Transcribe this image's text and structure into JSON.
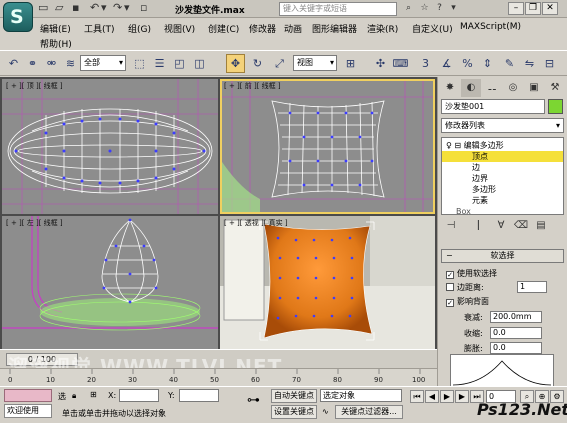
{
  "title": {
    "document": "沙发垫文件.max",
    "search_placeholder": "键入关键字或短语"
  },
  "menu": {
    "row1": [
      "编辑(E)",
      "工具(T)",
      "组(G)",
      "视图(V)",
      "创建(C)",
      "修改器",
      "动画",
      "图形编辑器",
      "渲染(R)",
      "自定义(U)",
      "MAXScript(M)"
    ],
    "row2": [
      "帮助(H)"
    ]
  },
  "toolbar": {
    "selection_filter": "全部",
    "ref_coord": "视图"
  },
  "viewports": {
    "top": "[ + ][ 顶 ][ 线框 ]",
    "front": "[ + ][ 前 ][ 线框 ]",
    "left": "[ + ][ 左 ][ 线框 ]",
    "persp": "[ + ][ 透视 ][ 真实 ]"
  },
  "command_panel": {
    "object_name": "沙发垫001",
    "object_color": "#7cd632",
    "modifier_list": "修改器列表",
    "stack": [
      "编辑多边形",
      "顶点",
      "边",
      "边界",
      "多边形",
      "元素",
      "Box"
    ],
    "stack_selected": "顶点",
    "rollout_title": "软选择",
    "use_soft_select": "使用软选择",
    "edge_distance": "边距离:",
    "edge_distance_value": "1",
    "affect_backfacing": "影响背面",
    "falloff_label": "衰减:",
    "falloff_value": "200.0mm",
    "pinch_label": "收缩:",
    "pinch_value": "0.0",
    "bubble_label": "膨胀:",
    "bubble_value": "0.0"
  },
  "timeline": {
    "slider_label": "0 / 100",
    "ticks": [
      "0",
      "10",
      "20",
      "30",
      "40",
      "50",
      "60",
      "70",
      "80",
      "90",
      "100"
    ]
  },
  "status": {
    "welcome": "欢迎使用",
    "selected": "选",
    "prompt": "单击或单击并拖动以选择对象",
    "x_label": "X:",
    "y_label": "Y:",
    "auto_key": "自动关键点",
    "set_key": "设置关键点",
    "selected_object": "选定对象",
    "key_filters": "关键点过滤器...",
    "frame_value": "0"
  },
  "watermark": {
    "site_left": "WWW.TLVI.NET",
    "site_left_cjk": "溜溜视觉",
    "site_right": "Ps123.Net"
  },
  "colors": {
    "wire_white": "#ffffff",
    "wire_magenta": "#c83cc8",
    "wire_green": "#96ff64",
    "vertex_blue": "#3c3cff",
    "cushion_orange": "#e07818",
    "selection_yellow": "#f5e03a"
  }
}
